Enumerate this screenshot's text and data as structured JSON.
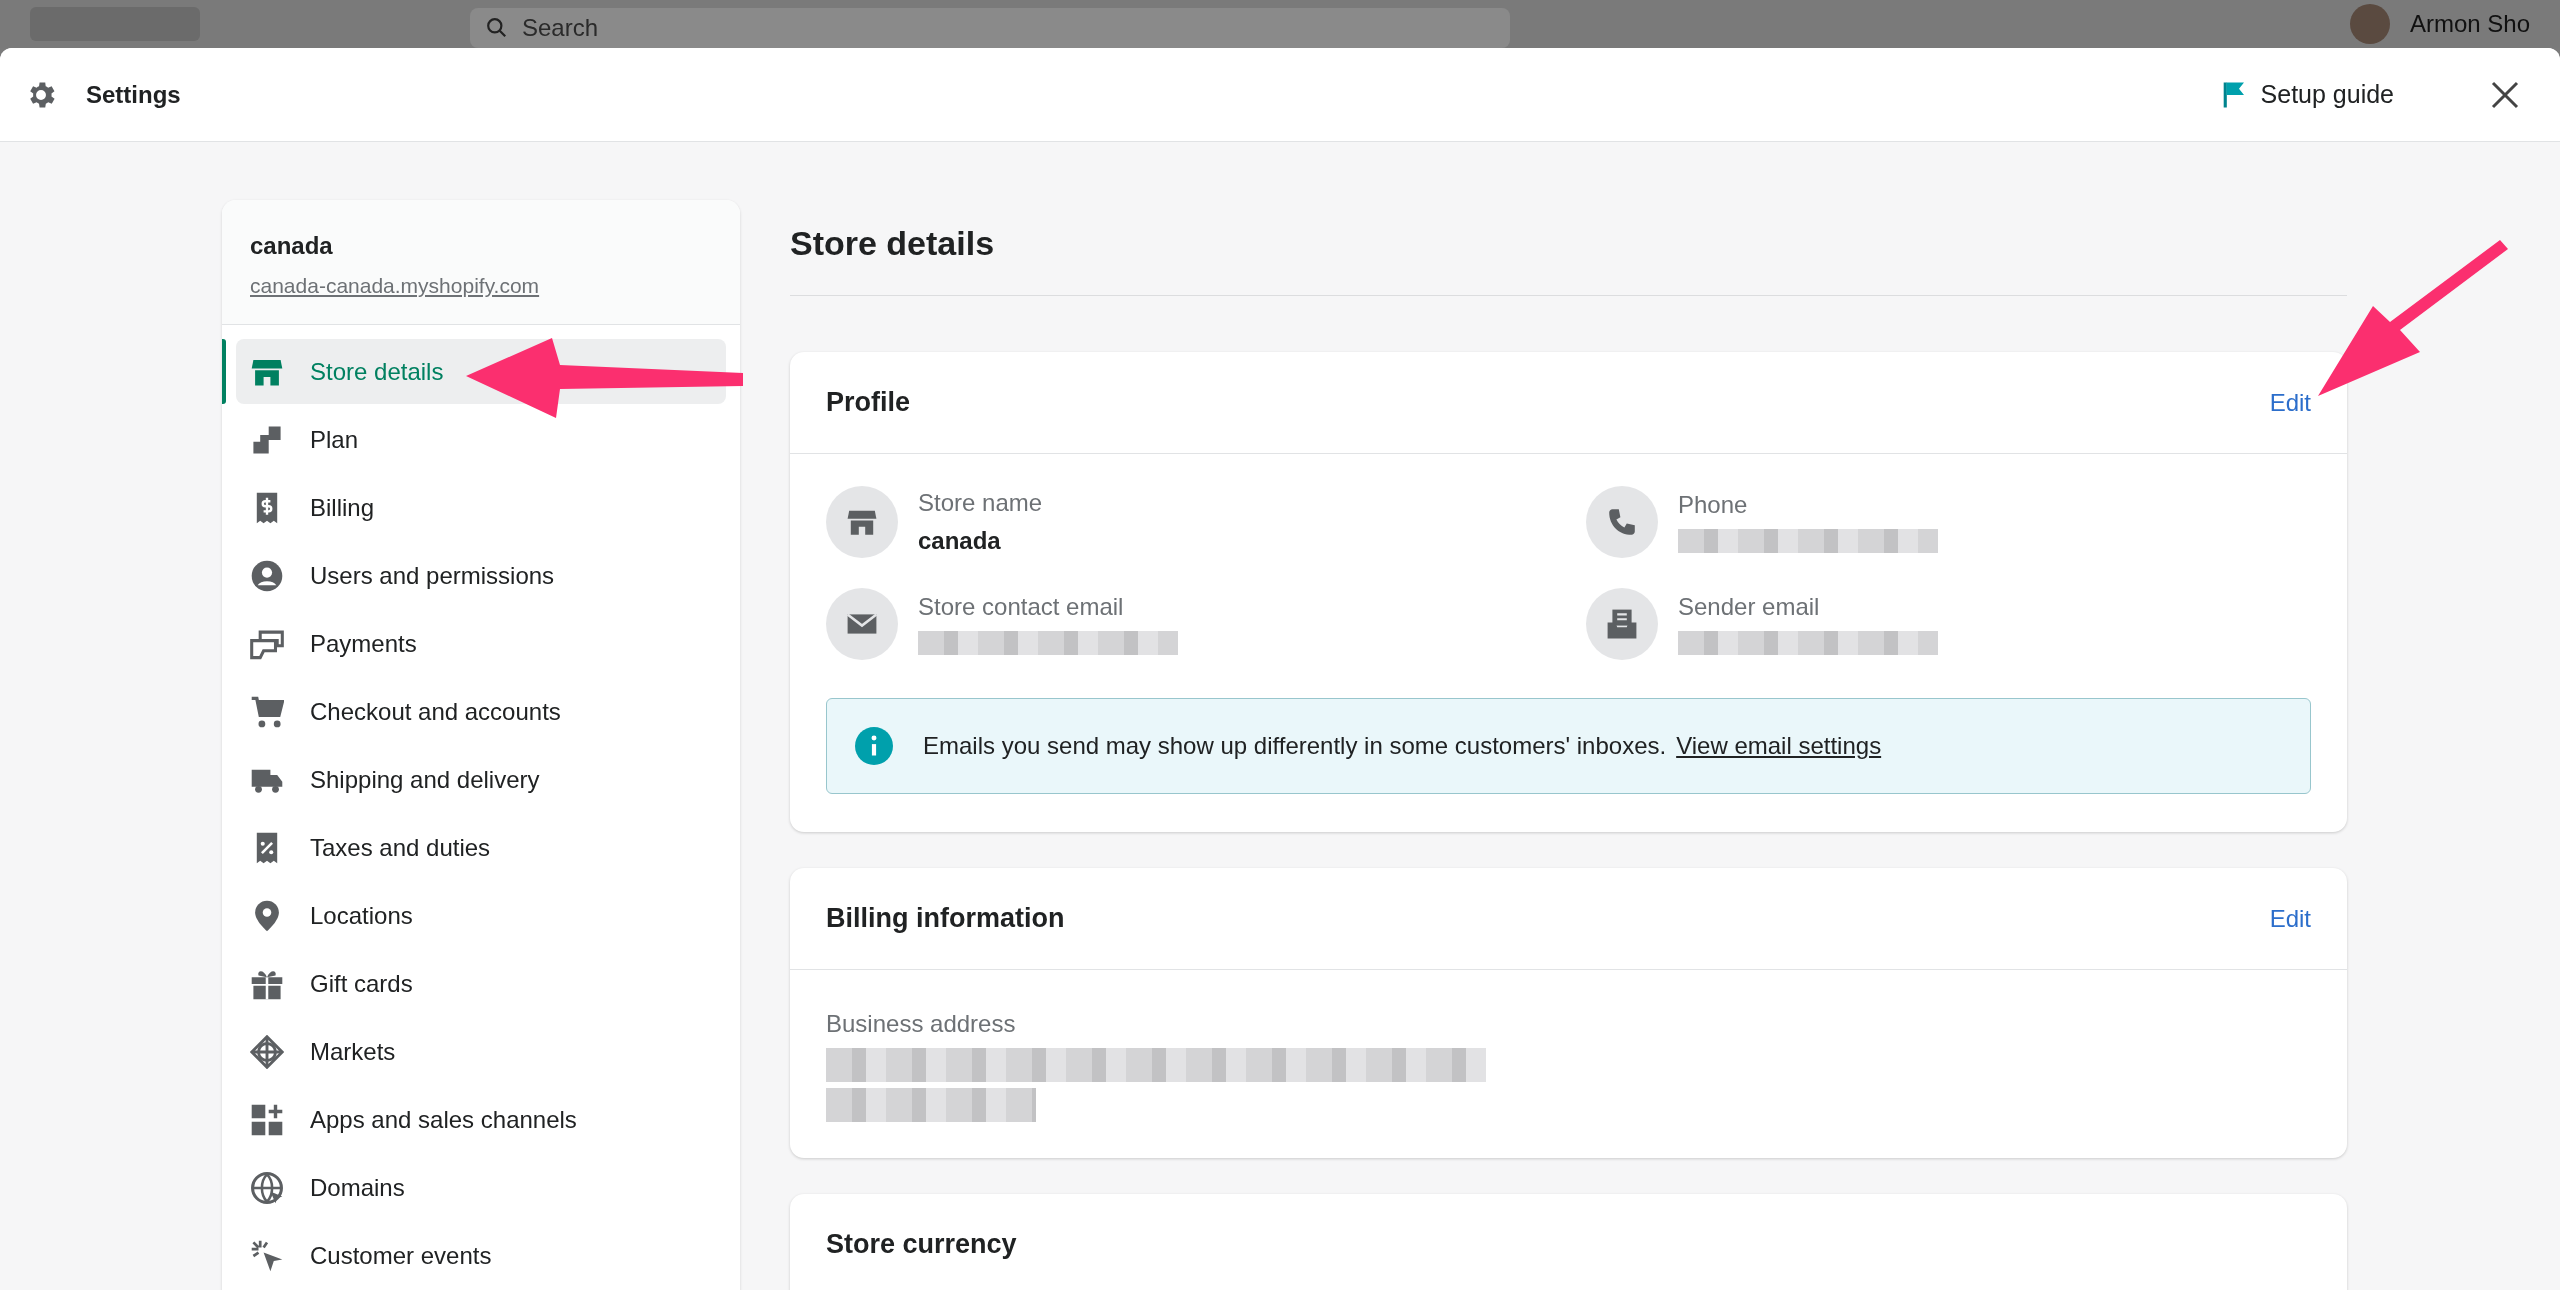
{
  "backdrop": {
    "search": {
      "placeholder": "Search"
    },
    "user_name": "Armon Sho"
  },
  "header": {
    "title": "Settings",
    "setup_guide": "Setup guide"
  },
  "sidebar": {
    "store_name": "canada",
    "store_url": "canada-canada.myshopify.com",
    "items": [
      {
        "label": "Store details",
        "selected": true
      },
      {
        "label": "Plan",
        "selected": false
      },
      {
        "label": "Billing",
        "selected": false
      },
      {
        "label": "Users and permissions",
        "selected": false
      },
      {
        "label": "Payments",
        "selected": false
      },
      {
        "label": "Checkout and accounts",
        "selected": false
      },
      {
        "label": "Shipping and delivery",
        "selected": false
      },
      {
        "label": "Taxes and duties",
        "selected": false
      },
      {
        "label": "Locations",
        "selected": false
      },
      {
        "label": "Gift cards",
        "selected": false
      },
      {
        "label": "Markets",
        "selected": false
      },
      {
        "label": "Apps and sales channels",
        "selected": false
      },
      {
        "label": "Domains",
        "selected": false
      },
      {
        "label": "Customer events",
        "selected": false
      }
    ]
  },
  "page_title": "Store details",
  "profile": {
    "title": "Profile",
    "edit": "Edit",
    "fields": [
      {
        "label": "Store name",
        "kind": "text",
        "value": "canada"
      },
      {
        "label": "Phone",
        "kind": "redacted"
      },
      {
        "label": "Store contact email",
        "kind": "redacted"
      },
      {
        "label": "Sender email",
        "kind": "redacted"
      }
    ],
    "banner": {
      "text": "Emails you send may show up differently in some customers' inboxes.",
      "link": "View email settings"
    }
  },
  "billing": {
    "title": "Billing information",
    "edit": "Edit",
    "address_label": "Business address"
  },
  "currency": {
    "title": "Store currency"
  }
}
